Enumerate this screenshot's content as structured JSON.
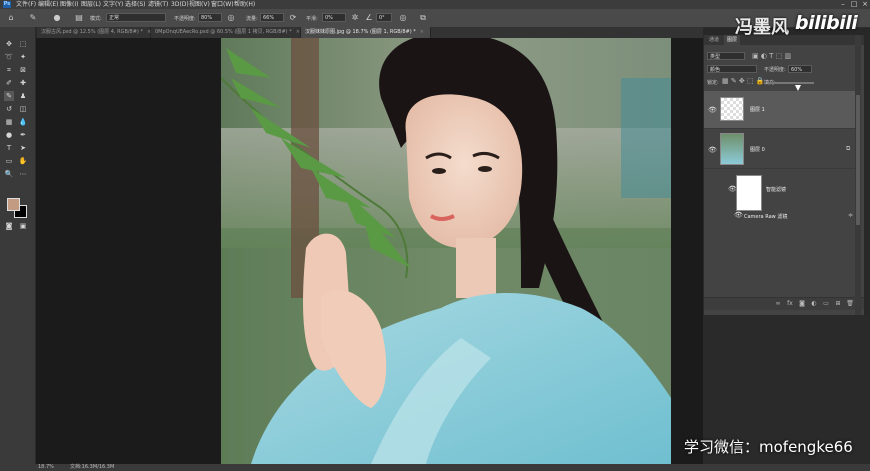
{
  "menubar": {
    "logo": "Ps",
    "items": [
      "文件(F)",
      "编辑(E)",
      "图像(I)",
      "图层(L)",
      "文字(Y)",
      "选择(S)",
      "滤镜(T)",
      "3D(D)",
      "视图(V)",
      "窗口(W)",
      "帮助(H)"
    ]
  },
  "options": {
    "mode_label": "模式:",
    "mode_value": "正常",
    "opacity_label": "不透明度:",
    "opacity_value": "80%",
    "flow_label": "流量:",
    "flow_value": "66%",
    "smooth_label": "平滑:",
    "smooth_value": "0%",
    "angle_value": "0°"
  },
  "tabs": [
    "汉服古风.psd @ 12.5% (图层 4, RGB/8#) *",
    "0MpOnqUEAecRo.psd @ 60.5% (图层 1 拷贝, RGB/8#) *",
    "汉服妹妹原图.jpg @ 18.7% (图层 1, RGB/8#) *"
  ],
  "tab_close": "×",
  "panel": {
    "tabs": [
      "通道",
      "图层"
    ],
    "kind_label": "类型",
    "blend_value": "颜色",
    "opacity_label": "不透明度:",
    "opacity_value": "60%",
    "lock_label": "锁定:",
    "fill_label": "填充:",
    "layers": [
      {
        "name": "图层 1"
      },
      {
        "name": "图层 0"
      },
      {
        "name": "智能滤镜"
      },
      {
        "name": "Camera Raw 滤镜"
      }
    ]
  },
  "status": {
    "zoom": "18.7%",
    "doc": "文档:16.3M/16.3M"
  },
  "watermark": {
    "author": "冯墨风",
    "brand": "bilibili",
    "contact": "学习微信：mofengke66"
  },
  "colors": {
    "foreground": "#c39a82",
    "background": "#000000"
  }
}
